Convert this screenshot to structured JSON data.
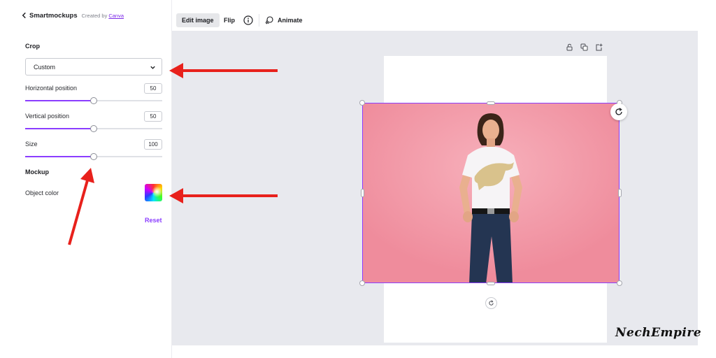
{
  "panel": {
    "app_name": "Smartmockups",
    "created_by": "Created by",
    "created_link": "Canva",
    "crop": {
      "title": "Crop",
      "dropdown_value": "Custom",
      "horizontal": {
        "label": "Horizontal position",
        "value": "50",
        "slider_fraction": 0.5
      },
      "vertical": {
        "label": "Vertical position",
        "value": "50",
        "slider_fraction": 0.5
      },
      "size": {
        "label": "Size",
        "value": "100",
        "slider_fraction": 0.5
      }
    },
    "mockup": {
      "title": "Mockup",
      "object_color_label": "Object color"
    },
    "reset_label": "Reset"
  },
  "toolbar": {
    "edit_image": "Edit image",
    "flip": "Flip",
    "animate": "Animate"
  },
  "watermark": "NechEmpire",
  "colors": {
    "accent": "#8b3dff",
    "arrow": "#e8211c",
    "photo_background": "#f0919f"
  },
  "icons": [
    "back-chevron-icon",
    "chevron-down-icon",
    "info-icon",
    "animate-icon",
    "lock-icon",
    "duplicate-icon",
    "add-page-icon",
    "rotate-icon"
  ]
}
